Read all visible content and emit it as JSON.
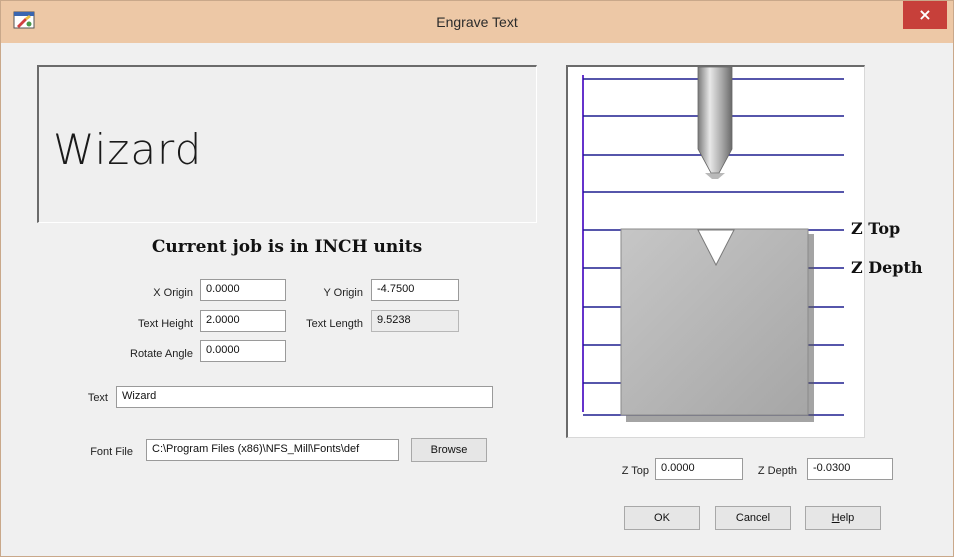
{
  "window": {
    "title": "Engrave Text",
    "close_label": "×"
  },
  "preview": {
    "text": "Wizard"
  },
  "units_heading": "Current job is in INCH units",
  "fields": {
    "x_origin": {
      "label": "X Origin",
      "value": "0.0000"
    },
    "y_origin": {
      "label": "Y Origin",
      "value": "-4.7500"
    },
    "text_height": {
      "label": "Text Height",
      "value": "2.0000"
    },
    "text_length": {
      "label": "Text Length",
      "value": "9.5238"
    },
    "rotate_angle": {
      "label": "Rotate Angle",
      "value": "0.0000"
    },
    "text": {
      "label": "Text",
      "value": "Wizard"
    },
    "font_file": {
      "label": "Font File",
      "value": "C:\\Program Files (x86)\\NFS_Mill\\Fonts\\def"
    }
  },
  "buttons": {
    "browse": "Browse",
    "ok": "OK",
    "cancel": "Cancel",
    "help": "Help"
  },
  "diagram": {
    "z_top_label": "Z Top",
    "z_depth_label": "Z Depth"
  },
  "z_fields": {
    "z_top": {
      "label": "Z Top",
      "value": "0.0000"
    },
    "z_depth": {
      "label": "Z Depth",
      "value": "-0.0300"
    }
  },
  "colors": {
    "titlebar": "#edc8a6",
    "close": "#c7403a",
    "line_blue": "#2222aa",
    "line_purple": "#9a4ad0"
  }
}
